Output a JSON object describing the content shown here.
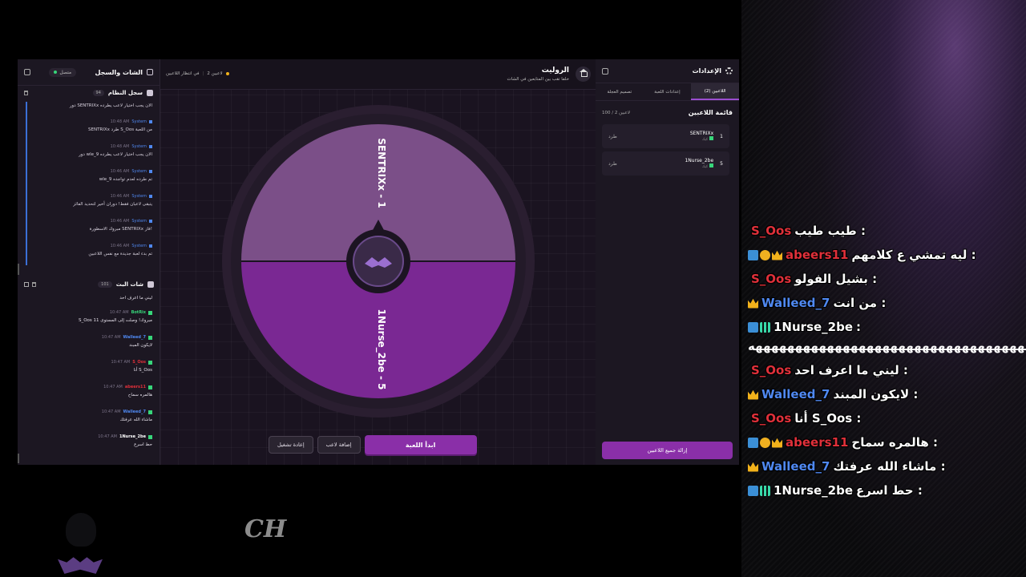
{
  "log_panel": {
    "title": "الشات والسجل",
    "status": "متصل",
    "system_section": {
      "title": "سجل النظام",
      "count": "94"
    },
    "system_first": "دور SENTRIXx الان يجب اختيار لاعب يطرده",
    "system_items": [
      {
        "time": "10:48 AM",
        "sender": "System",
        "text": "SENTRIXx طرد S_Oos من اللعبة"
      },
      {
        "time": "10:48 AM",
        "sender": "System",
        "text": "دور wle_9 الان يجب اختيار لاعب يطرده"
      },
      {
        "time": "10:46 AM",
        "sender": "System",
        "text": "wle_9 تم طرده لعدم تواجده"
      },
      {
        "time": "10:46 AM",
        "sender": "System",
        "text": "يتبقى لاعبان فقط! دوران أخير لتحديد الفائز"
      },
      {
        "time": "10:46 AM",
        "sender": "System",
        "text": "مبروك الاسطورة SENTRIXx فاز!"
      },
      {
        "time": "10:46 AM",
        "sender": "System",
        "text": "تم بدء لعبة جديدة مع نفس اللاعبين"
      }
    ],
    "chat_section": {
      "title": "شات البث",
      "count": "101"
    },
    "chat_first": "ليني ما اعرف احد",
    "chat_items": [
      {
        "time": "10:47 AM",
        "user": "BotRix",
        "user_color": "#37d67a",
        "text": "S_Oos مبروك! وصلت إلى المستوى 11"
      },
      {
        "time": "10:47 AM",
        "user": "Walleed_7",
        "user_color": "#4f88f0",
        "text": "لايكون المبند"
      },
      {
        "time": "10:47 AM",
        "user": "S_Oos",
        "user_color": "#e0303a",
        "text": "أنا S_Oos"
      },
      {
        "time": "10:47 AM",
        "user": "abeers11",
        "user_color": "#e0303a",
        "text": "هالمره سماح"
      },
      {
        "time": "10:47 AM",
        "user": "Walleed_7",
        "user_color": "#4f88f0",
        "text": "ماشاء الله عرفتك"
      },
      {
        "time": "10:47 AM",
        "user": "1Nurse_2be",
        "user_color": "#ffffff",
        "text": "حط اسرع"
      }
    ]
  },
  "center": {
    "title": "الروليت",
    "subtitle": "خلفا تقب بين المتابعين في الشات",
    "status_players": "2 لاعبين",
    "status_waiting": "في انتظار اللاعبين",
    "wheel": {
      "segments": [
        {
          "label": "SENTRIXx - 1",
          "color": "#7b4f88"
        },
        {
          "label": "1Nurse_2be - 5",
          "color": "#7a2893"
        }
      ]
    },
    "buttons": {
      "start": "ابدأ اللعبة",
      "add_player": "إضافة لاعب",
      "restart": "إعادة تشغيل"
    }
  },
  "settings": {
    "title": "الإعدادات",
    "tabs": [
      "اللاعبين (2)",
      "إعدادات اللعبة",
      "تصميم العجلة"
    ],
    "players_title": "قائمة اللاعبين",
    "players_count": "100 / 2 لاعبين",
    "players": [
      {
        "num": "1",
        "name": "SENTRIXx",
        "sub": "كيك",
        "kick": "طرد"
      },
      {
        "num": "5",
        "name": "1Nurse_2be",
        "sub": "كيك",
        "kick": "طرد"
      }
    ],
    "remove_all": "إزالة جميع اللاعبين"
  },
  "overlay_chat": [
    {
      "user": "S_Oos",
      "color": "#e0303a",
      "badges": [],
      "msg": "طيب طيب :"
    },
    {
      "user": "abeers11",
      "color": "#e0303a",
      "badges": [
        "arrow",
        "num",
        "crown"
      ],
      "msg": "ليه تمشي ع كلامهم :"
    },
    {
      "user": "S_Oos",
      "color": "#e0303a",
      "badges": [],
      "msg": "بشيل الفولو :"
    },
    {
      "user": "Walleed_7",
      "color": "#4f88f0",
      "badges": [
        "crown"
      ],
      "msg": "من انت :"
    },
    {
      "user": "1Nurse_2be",
      "color": "#ffffff",
      "badges": [
        "arrow",
        "bars"
      ],
      "msg": ":",
      "cont": "هههههههههههههههههههههههههههههههههههههههههههههههه"
    },
    {
      "user": "S_Oos",
      "color": "#e0303a",
      "badges": [],
      "msg": "ليني ما اعرف احد :"
    },
    {
      "user": "Walleed_7",
      "color": "#4f88f0",
      "badges": [
        "crown"
      ],
      "msg": "لايكون المبند :"
    },
    {
      "user": "S_Oos",
      "color": "#e0303a",
      "badges": [],
      "msg": "أنا S_Oos :"
    },
    {
      "user": "abeers11",
      "color": "#e0303a",
      "badges": [
        "arrow",
        "num",
        "crown"
      ],
      "msg": "هالمره سماح :"
    },
    {
      "user": "Walleed_7",
      "color": "#4f88f0",
      "badges": [
        "crown"
      ],
      "msg": "ماشاء الله عرفتك :"
    },
    {
      "user": "1Nurse_2be",
      "color": "#ffffff",
      "badges": [
        "arrow",
        "bars"
      ],
      "msg": "حط اسرع :"
    }
  ],
  "logo_text": "CH"
}
